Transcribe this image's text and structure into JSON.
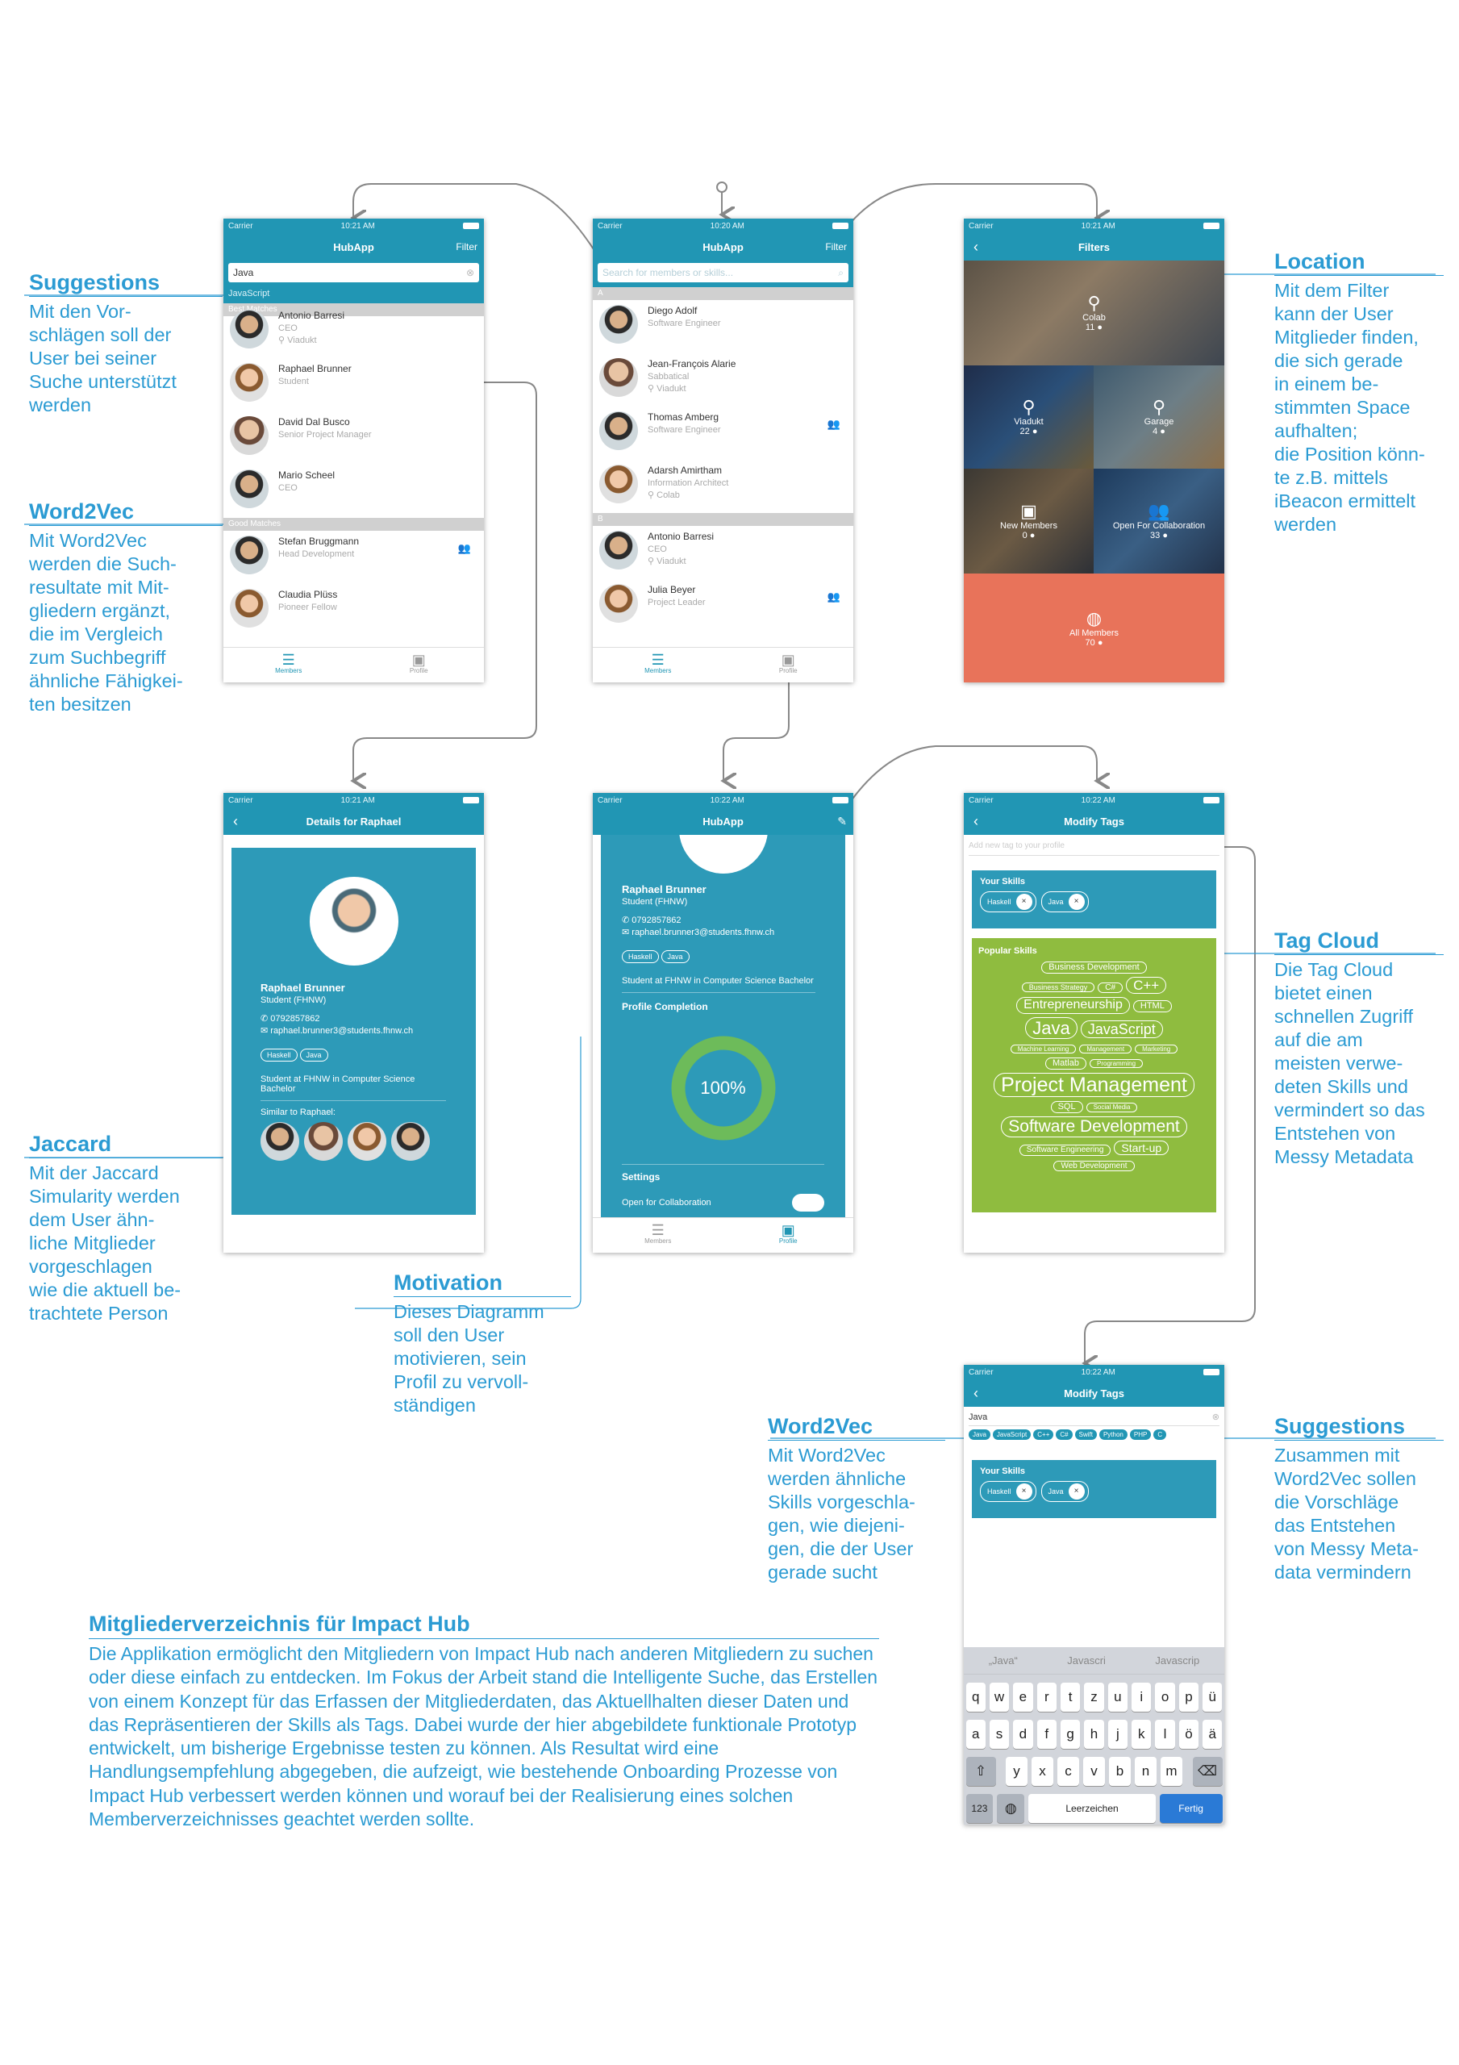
{
  "annotations": {
    "suggestions_left": {
      "title": "Suggestions",
      "text": "Mit den Vor-\nschlägen soll der\nUser bei seiner\nSuche unterstützt\nwerden"
    },
    "word2vec_left": {
      "title": "Word2Vec",
      "text": "Mit Word2Vec\nwerden die Such-\nresultate mit Mit-\ngliedern ergänzt,\ndie im Vergleich\nzum Suchbegriff\nähnliche Fähigkei-\nten besitzen"
    },
    "jaccard": {
      "title": "Jaccard",
      "text": "Mit der Jaccard\nSimularity werden\ndem User ähn-\nliche Mitglieder\nvorgeschlagen\nwie die aktuell be-\ntrachtete Person"
    },
    "motivation": {
      "title": "Motivation",
      "text": "Dieses Diagramm\nsoll den User\nmotivieren, sein\nProfil zu vervoll-\nständigen"
    },
    "location": {
      "title": "Location",
      "text": "Mit dem Filter\nkann der User\nMitglieder finden,\ndie sich gerade\nin einem be-\nstimmten Space\naufhalten;\ndie Position könn-\nte z.B. mittels\niBeacon ermittelt\nwerden"
    },
    "tag_cloud": {
      "title": "Tag Cloud",
      "text": "Die Tag Cloud\nbietet einen\nschnellen Zugriff\nauf die am\nmeisten verwe-\ndeten Skills und\nvermindert so das\nEntstehen von\nMessy Metadata"
    },
    "word2vec_right": {
      "title": "Word2Vec",
      "text": "Mit Word2Vec\nwerden ähnliche\nSkills vorgeschla-\ngen, wie diejeni-\ngen, die der User\ngerade sucht"
    },
    "suggestions_right": {
      "title": "Suggestions",
      "text": "Zusammen mit\nWord2Vec sollen\ndie Vorschläge\ndas Entstehen\nvon Messy Meta-\ndata vermindern"
    }
  },
  "summary": {
    "title": "Mitgliederverzeichnis für Impact Hub",
    "text": "Die Applikation ermöglicht den Mitgliedern von Impact Hub nach anderen Mitgliedern zu suchen oder diese einfach zu entdecken. Im Fokus der Arbeit stand die Intelligente Suche, das Erstellen von einem Konzept für das Erfassen der Mitgliederdaten, das Aktuellhalten dieser Daten und das Repräsentieren der Skills als Tags. Dabei wurde der hier abgebildete funktionale Prototyp entwickelt, um bisherige Ergebnisse testen zu können. Als Resultat wird eine Handlungsempfehlung abgegeben, die aufzeigt, wie bestehende Onboarding Prozesse von Impact Hub verbessert werden können und worauf bei der Realisierung eines solchen Memberverzeichnisses geachtet werden sollte."
  },
  "phone1": {
    "carrier": "Carrier",
    "time": "10:21 AM",
    "title": "HubApp",
    "filter": "Filter",
    "search_value": "Java",
    "suggestion": "JavaScript",
    "section_best": "Best Matches",
    "section_good": "Good Matches",
    "rows": [
      {
        "name": "Antonio Barresi",
        "role": "CEO",
        "loc": "Viadukt"
      },
      {
        "name": "Raphael Brunner",
        "role": "Student",
        "loc": ""
      },
      {
        "name": "David Dal Busco",
        "role": "Senior Project Manager",
        "loc": ""
      },
      {
        "name": "Mario Scheel",
        "role": "CEO",
        "loc": ""
      },
      {
        "name": "Stefan Bruggmann",
        "role": "Head Development",
        "loc": ""
      },
      {
        "name": "Claudia Plüss",
        "role": "Pioneer Fellow",
        "loc": ""
      }
    ],
    "tab_members": "Members",
    "tab_profile": "Profile"
  },
  "phone2": {
    "carrier": "Carrier",
    "time": "10:20 AM",
    "title": "HubApp",
    "filter": "Filter",
    "search_placeholder": "Search for members or skills...",
    "section_a": "A",
    "section_b": "B",
    "rows": [
      {
        "name": "Diego Adolf",
        "role": "Software Engineer",
        "loc": ""
      },
      {
        "name": "Jean-François Alarie",
        "role": "Sabbatical",
        "loc": "Viadukt"
      },
      {
        "name": "Thomas Amberg",
        "role": "Software Engineer",
        "loc": ""
      },
      {
        "name": "Adarsh Amirtham",
        "role": "Information Architect",
        "loc": "Colab"
      },
      {
        "name": "Antonio Barresi",
        "role": "CEO",
        "loc": "Viadukt"
      },
      {
        "name": "Julia Beyer",
        "role": "Project Leader",
        "loc": ""
      }
    ],
    "tab_members": "Members",
    "tab_profile": "Profile"
  },
  "phone3": {
    "carrier": "Carrier",
    "time": "10:21 AM",
    "title": "Filters",
    "tiles": [
      {
        "name": "Colab",
        "count": "11"
      },
      {
        "name": "Viadukt",
        "count": "22"
      },
      {
        "name": "Garage",
        "count": "4"
      },
      {
        "name": "New Members",
        "count": "0"
      },
      {
        "name": "Open For Collaboration",
        "count": "33"
      }
    ],
    "all": {
      "name": "All Members",
      "count": "70"
    }
  },
  "phone4": {
    "carrier": "Carrier",
    "time": "10:21 AM",
    "title": "Details for Raphael",
    "name": "Raphael Brunner",
    "role": "Student (FHNW)",
    "phone": "0792857862",
    "email": "raphael.brunner3@students.fhnw.ch",
    "tags": [
      "Haskell",
      "Java"
    ],
    "bio": "Student at FHNW in Computer Science Bachelor",
    "similar": "Similar to Raphael:"
  },
  "phone5": {
    "carrier": "Carrier",
    "time": "10:22 AM",
    "title": "HubApp",
    "name": "Raphael Brunner",
    "role": "Student (FHNW)",
    "phone": "0792857862",
    "email": "raphael.brunner3@students.fhnw.ch",
    "tags": [
      "Haskell",
      "Java"
    ],
    "bio": "Student at FHNW in Computer Science Bachelor",
    "completion_title": "Profile Completion",
    "completion_pct": "100%",
    "completion_value": 1.0,
    "settings": "Settings",
    "open_collab": "Open for Collaboration",
    "tab_members": "Members",
    "tab_profile": "Profile"
  },
  "phone6": {
    "carrier": "Carrier",
    "time": "10:22 AM",
    "title": "Modify Tags",
    "placeholder": "Add new tag to your profile",
    "your_skills": "Your Skills",
    "skills": [
      "Haskell",
      "Java"
    ],
    "popular": "Popular Skills",
    "cloud": [
      [
        {
          "t": "Business Development",
          "s": 11
        }
      ],
      [
        {
          "t": "Business Strategy",
          "s": 9
        },
        {
          "t": "C#",
          "s": 10
        },
        {
          "t": "C++",
          "s": 17
        }
      ],
      [
        {
          "t": "Entrepreneurship",
          "s": 16
        },
        {
          "t": "HTML",
          "s": 11
        }
      ],
      [
        {
          "t": "Java",
          "s": 22
        },
        {
          "t": "JavaScript",
          "s": 18
        }
      ],
      [
        {
          "t": "Machine Learning",
          "s": 8
        },
        {
          "t": "Management",
          "s": 8
        },
        {
          "t": "Marketing",
          "s": 8
        }
      ],
      [
        {
          "t": "Matlab",
          "s": 11
        },
        {
          "t": "Programming",
          "s": 8
        }
      ],
      [
        {
          "t": "Project Management",
          "s": 25
        }
      ],
      [
        {
          "t": "SQL",
          "s": 11
        },
        {
          "t": "Social Media",
          "s": 8
        }
      ],
      [
        {
          "t": "Software Development",
          "s": 21
        }
      ],
      [
        {
          "t": "Software Engineering",
          "s": 10
        },
        {
          "t": "Start-up",
          "s": 14
        }
      ],
      [
        {
          "t": "Web Development",
          "s": 10
        }
      ]
    ]
  },
  "phone7": {
    "carrier": "Carrier",
    "time": "10:22 AM",
    "title": "Modify Tags",
    "value": "Java",
    "suggestions": [
      "Java",
      "JavaScript",
      "C++",
      "C#",
      "Swift",
      "Python",
      "PHP",
      "C"
    ],
    "your_skills": "Your Skills",
    "skills": [
      "Haskell",
      "Java"
    ],
    "predictions": [
      "„Java“",
      "Javascri",
      "Javascrip"
    ],
    "row1": [
      "q",
      "w",
      "e",
      "r",
      "t",
      "z",
      "u",
      "i",
      "o",
      "p",
      "ü"
    ],
    "row2": [
      "a",
      "s",
      "d",
      "f",
      "g",
      "h",
      "j",
      "k",
      "l",
      "ö",
      "ä"
    ],
    "row3": [
      "y",
      "x",
      "c",
      "v",
      "b",
      "n",
      "m"
    ],
    "key_123": "123",
    "space": "Leerzeichen",
    "done": "Fertig"
  },
  "colors": {
    "teal": "#2196b4",
    "annotation": "#2b9bd3",
    "coral": "#e8735a",
    "green": "#8fbc3f"
  },
  "icons": [
    "back-chevron-icon",
    "pin-icon",
    "person-icon",
    "group-icon",
    "globe-icon",
    "list-icon",
    "profile-icon",
    "clear-icon",
    "search-icon",
    "phone-icon",
    "mail-icon",
    "gear-icon",
    "globe-key-icon",
    "shift-icon",
    "backspace-icon"
  ]
}
